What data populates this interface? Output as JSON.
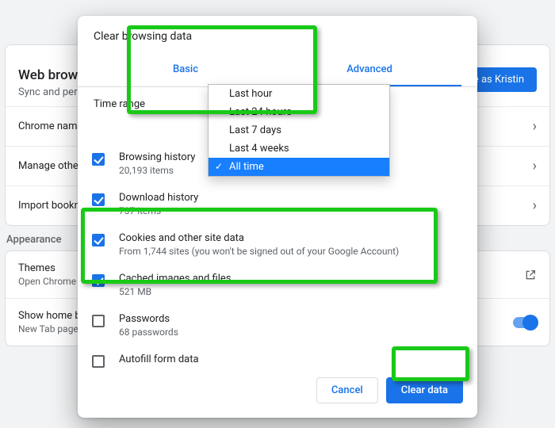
{
  "background": {
    "swirl_color_a": "#4285f4",
    "swirl_color_b": "#fbbc04",
    "web_browser_title": "Web browser",
    "web_browser_sub": "Sync and personalize Chrome across your devices",
    "rows": [
      {
        "label": "Chrome name and picture"
      },
      {
        "label": "Manage other people"
      },
      {
        "label": "Import bookmarks and settings"
      }
    ],
    "pill_label": "Continue as Kristin",
    "appearance_title": "Appearance",
    "themes_label": "Themes",
    "themes_sub": "Open Chrome Web Store",
    "home_label": "Show home button",
    "home_sub": "New Tab page"
  },
  "modal": {
    "title": "Clear browsing data",
    "tabs": {
      "basic": "Basic",
      "advanced": "Advanced"
    },
    "time_label": "Time range",
    "dropdown": {
      "options": [
        "Last hour",
        "Last 24 hours",
        "Last 7 days",
        "Last 4 weeks",
        "All time"
      ],
      "selected_index": 4
    },
    "items": [
      {
        "title": "Browsing history",
        "sub": "20,193 items",
        "checked": true
      },
      {
        "title": "Download history",
        "sub": "737 items",
        "checked": true
      },
      {
        "title": "Cookies and other site data",
        "sub": "From 1,744 sites (you won't be signed out of your Google Account)",
        "checked": true
      },
      {
        "title": "Cached images and files",
        "sub": "521 MB",
        "checked": true
      },
      {
        "title": "Passwords",
        "sub": "68 passwords",
        "checked": false
      },
      {
        "title": "Autofill form data",
        "sub": "",
        "checked": false
      }
    ],
    "cancel_label": "Cancel",
    "clear_label": "Clear data"
  }
}
